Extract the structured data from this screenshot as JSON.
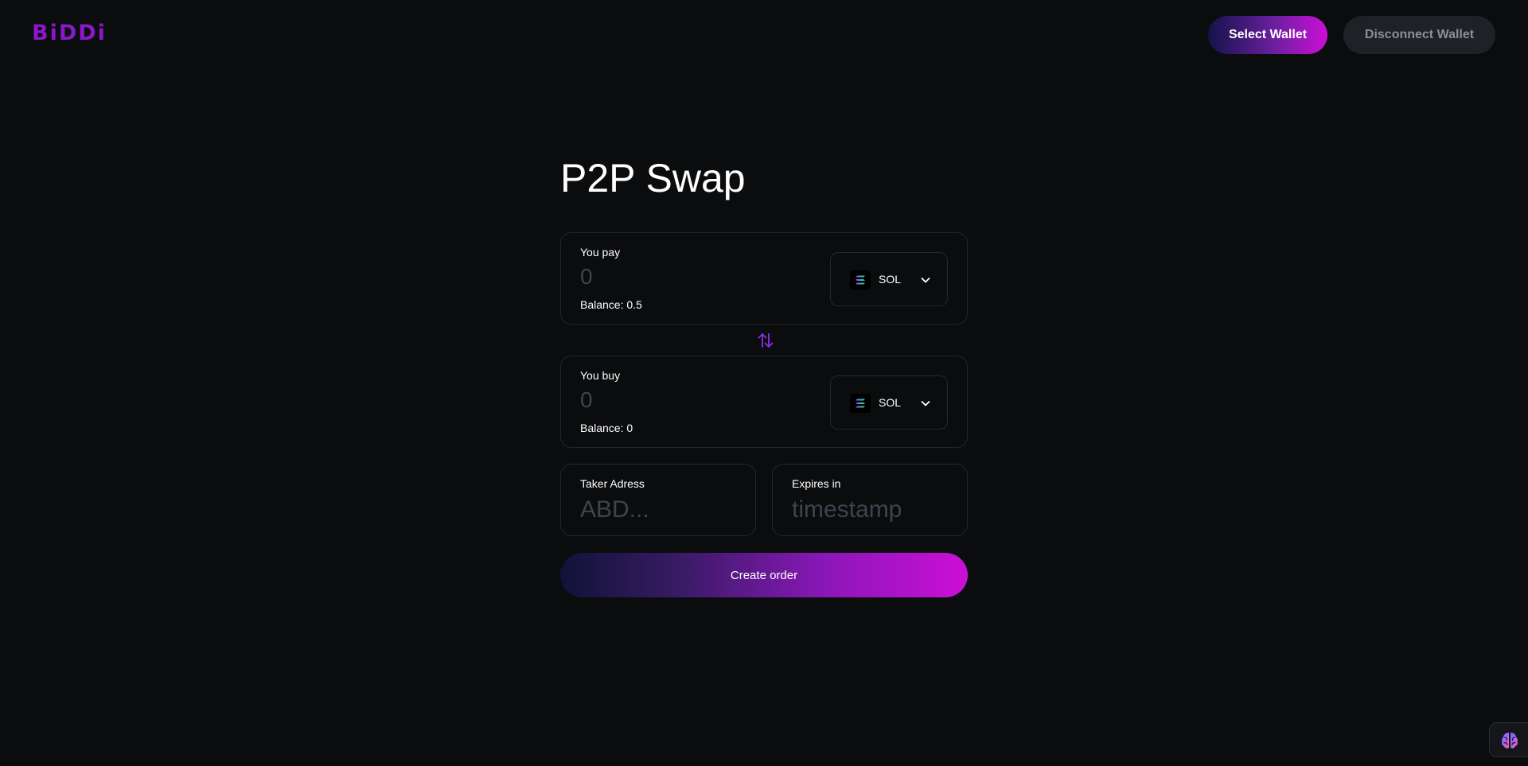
{
  "header": {
    "logo_text": "BiDDi",
    "select_wallet_label": "Select Wallet",
    "disconnect_wallet_label": "Disconnect Wallet"
  },
  "main": {
    "title": "P2P Swap",
    "pay": {
      "label": "You pay",
      "amount_placeholder": "0",
      "balance_text": "Balance: 0.5",
      "token": "SOL",
      "token_icon": "solana-icon"
    },
    "swap_icon": "swap-arrows-icon",
    "buy": {
      "label": "You buy",
      "amount_placeholder": "0",
      "balance_text": "Balance: 0",
      "token": "SOL",
      "token_icon": "solana-icon"
    },
    "taker": {
      "label": "Taker Adress",
      "placeholder": "ABD..."
    },
    "expires": {
      "label": "Expires in",
      "placeholder": "timestamp"
    },
    "create_order_label": "Create order"
  },
  "colors": {
    "background": "#0b0c0e",
    "accent_purple": "#8a17c9",
    "accent_magenta": "#cc0fd6",
    "card_border": "#24272c",
    "placeholder": "#3e444d"
  },
  "corner_widget_icon": "brain-icon"
}
